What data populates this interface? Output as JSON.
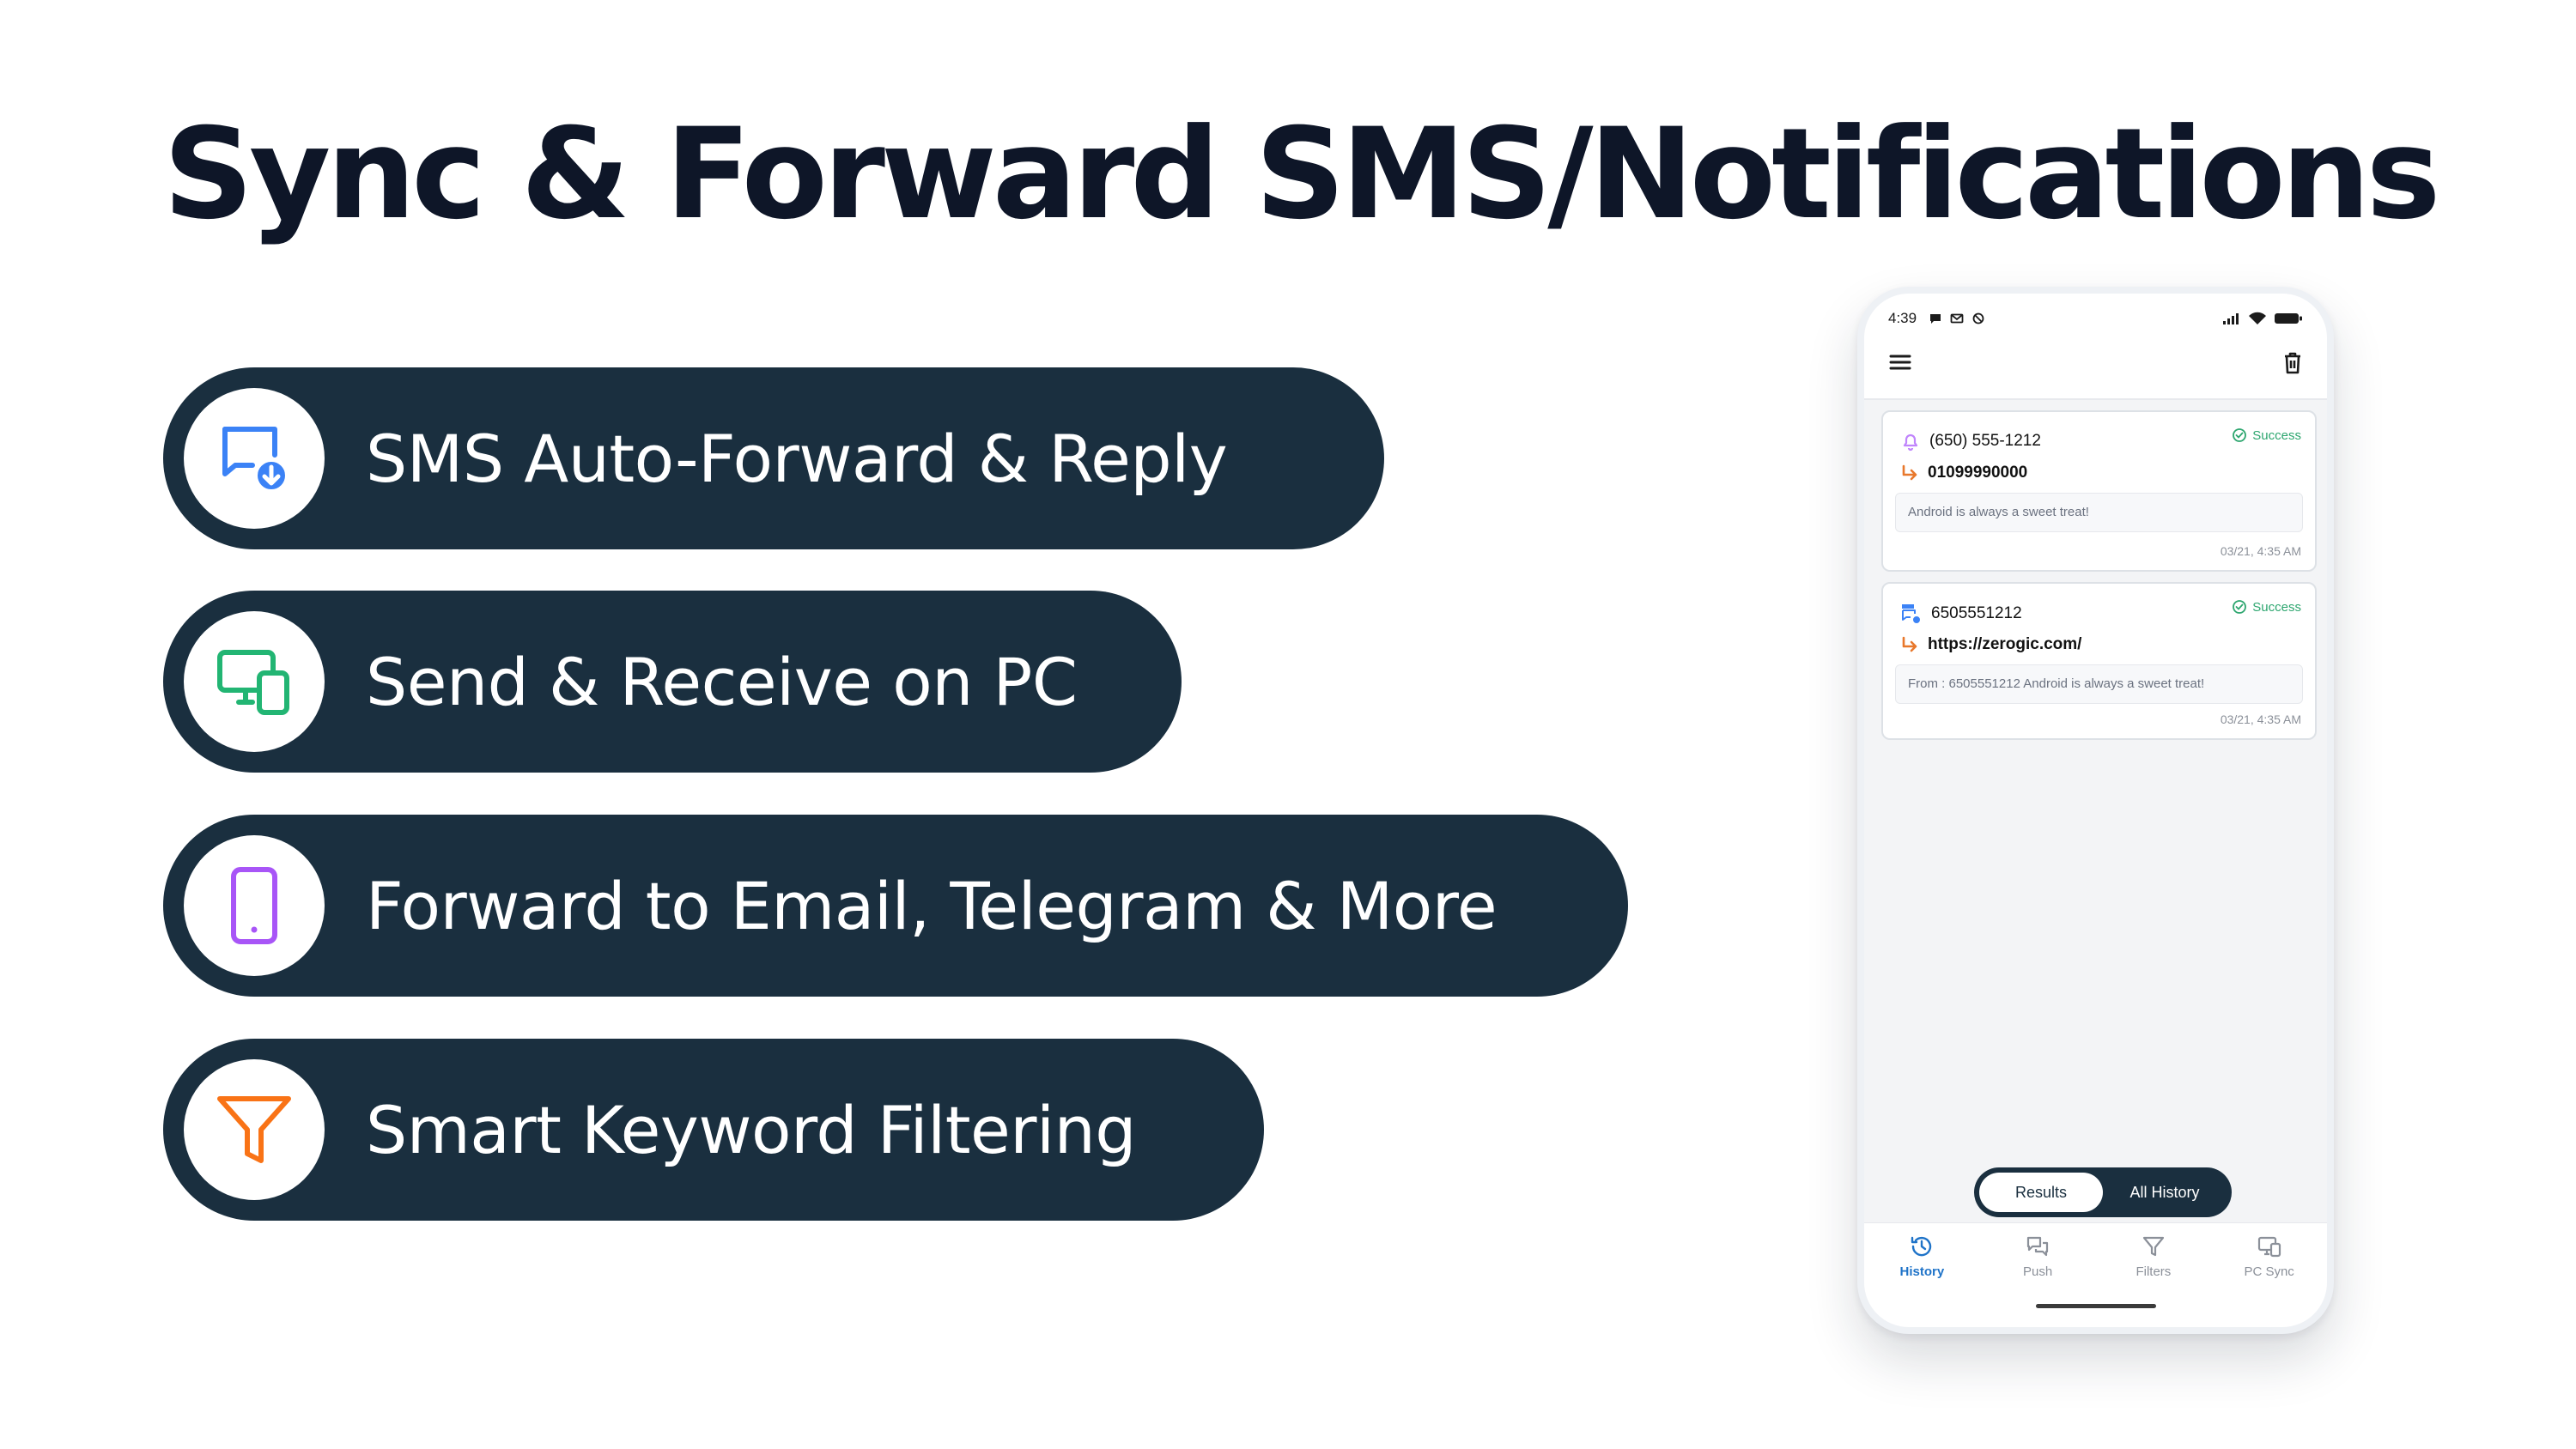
{
  "headline": "Sync & Forward SMS/Notifications",
  "features": [
    {
      "label": "SMS Auto-Forward & Reply",
      "icon": "sms-forward-icon",
      "color": "#3b82f6"
    },
    {
      "label": "Send & Receive on PC",
      "icon": "pc-sync-icon",
      "color": "#22b573"
    },
    {
      "label": "Forward to Email, Telegram & More",
      "icon": "phone-icon",
      "color": "#a855f7"
    },
    {
      "label": "Smart Keyword Filtering",
      "icon": "filter-icon",
      "color": "#f97316"
    }
  ],
  "phone": {
    "status_time": "4:39",
    "cards": [
      {
        "sender": "(650) 555-1212",
        "destination": "01099990000",
        "status": "Success",
        "message": "Android is always a sweet treat!",
        "timestamp": "03/21, 4:35 AM",
        "icon": "notification-bell-icon"
      },
      {
        "sender": "6505551212",
        "destination": "https://zerogic.com/",
        "status": "Success",
        "message": "From : 6505551212 Android is always a sweet treat!",
        "timestamp": "03/21, 4:35 AM",
        "icon": "sms-icon"
      }
    ],
    "segment": {
      "results": "Results",
      "all_history": "All History"
    },
    "nav": [
      {
        "label": "History",
        "icon": "history-icon"
      },
      {
        "label": "Push",
        "icon": "push-icon"
      },
      {
        "label": "Filters",
        "icon": "filter-icon"
      },
      {
        "label": "PC Sync",
        "icon": "pc-sync-icon"
      }
    ]
  },
  "colors": {
    "pill_bg": "#1a2f3f",
    "success": "#2da66f",
    "nav_active": "#1f73c8",
    "forward_arrow": "#e8782c"
  }
}
